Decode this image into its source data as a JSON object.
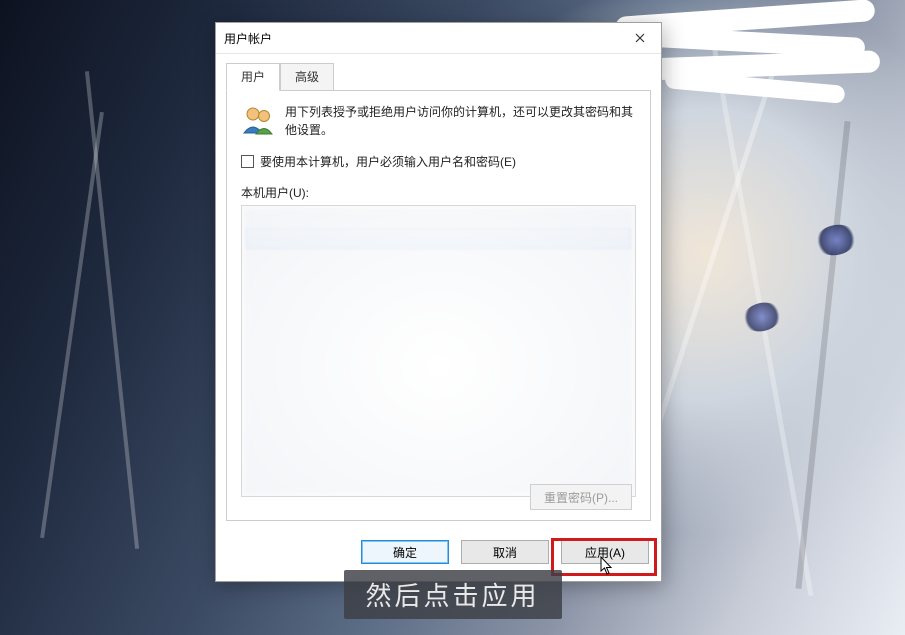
{
  "dialog": {
    "title": "用户帐户",
    "tabs": {
      "users": "用户",
      "advanced": "高级"
    },
    "intro": "用下列表授予或拒绝用户访问你的计算机，还可以更改其密码和其他设置。",
    "require_login_label": "要使用本计算机，用户必须输入用户名和密码(E)",
    "require_login_checked": false,
    "users_section_label": "本机用户(U):",
    "reset_password_label": "重置密码(P)...",
    "buttons": {
      "ok": "确定",
      "cancel": "取消",
      "apply": "应用(A)"
    }
  },
  "caption": "然后点击应用"
}
